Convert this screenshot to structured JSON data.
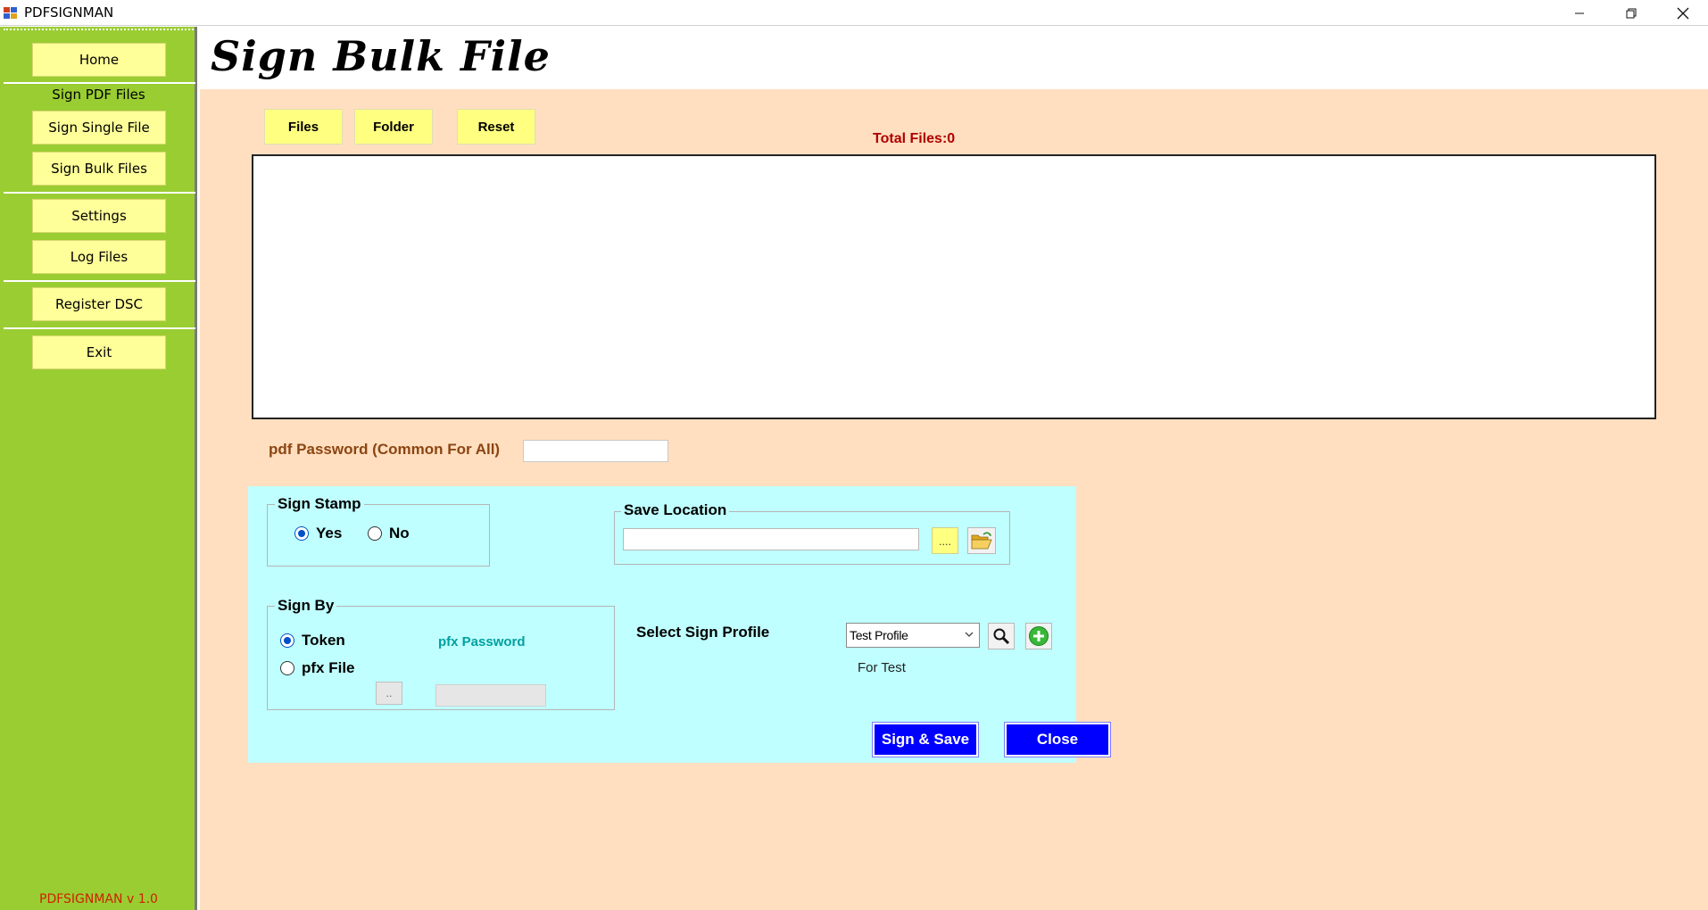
{
  "window": {
    "title": "PDFSIGNMAN",
    "controls": {
      "minimize": "—",
      "restore": "❐",
      "close": "✕"
    }
  },
  "sidebar": {
    "home": "Home",
    "sign_heading": "Sign PDF Files",
    "sign_single": "Sign Single File",
    "sign_bulk": "Sign Bulk Files",
    "settings": "Settings",
    "log_files": "Log Files",
    "register_dsc": "Register DSC",
    "exit": "Exit",
    "version": "PDFSIGNMAN v 1.0"
  },
  "page": {
    "title": "Sign Bulk File",
    "buttons": {
      "files": "Files",
      "folder": "Folder",
      "reset": "Reset"
    },
    "total_files": "Total Files:0",
    "pdf_password_label": "pdf Password (Common For All)",
    "pdf_password_value": ""
  },
  "sign_stamp": {
    "title": "Sign Stamp",
    "yes": "Yes",
    "no": "No",
    "selected": "yes"
  },
  "save_location": {
    "title": "Save Location",
    "value": "",
    "browse_label": "...."
  },
  "sign_by": {
    "title": "Sign By",
    "token": "Token",
    "pfx_file": "pfx File",
    "selected": "token",
    "pfx_password_label": "pfx Password",
    "pfx_browse_label": "..",
    "pfx_password_value": ""
  },
  "sign_profile": {
    "label": "Select Sign Profile",
    "selected": "Test Profile",
    "description": "For Test"
  },
  "actions": {
    "sign_save": "Sign & Save",
    "close": "Close"
  },
  "colors": {
    "sidebar": "#9acd32",
    "side_button": "#ffff99",
    "main_bg": "#ffdfbf",
    "panel_bg": "#c0ffff",
    "action_button": "#0000ff",
    "total_files_text": "#b00000",
    "pfx_password_text": "#00a0a0"
  }
}
